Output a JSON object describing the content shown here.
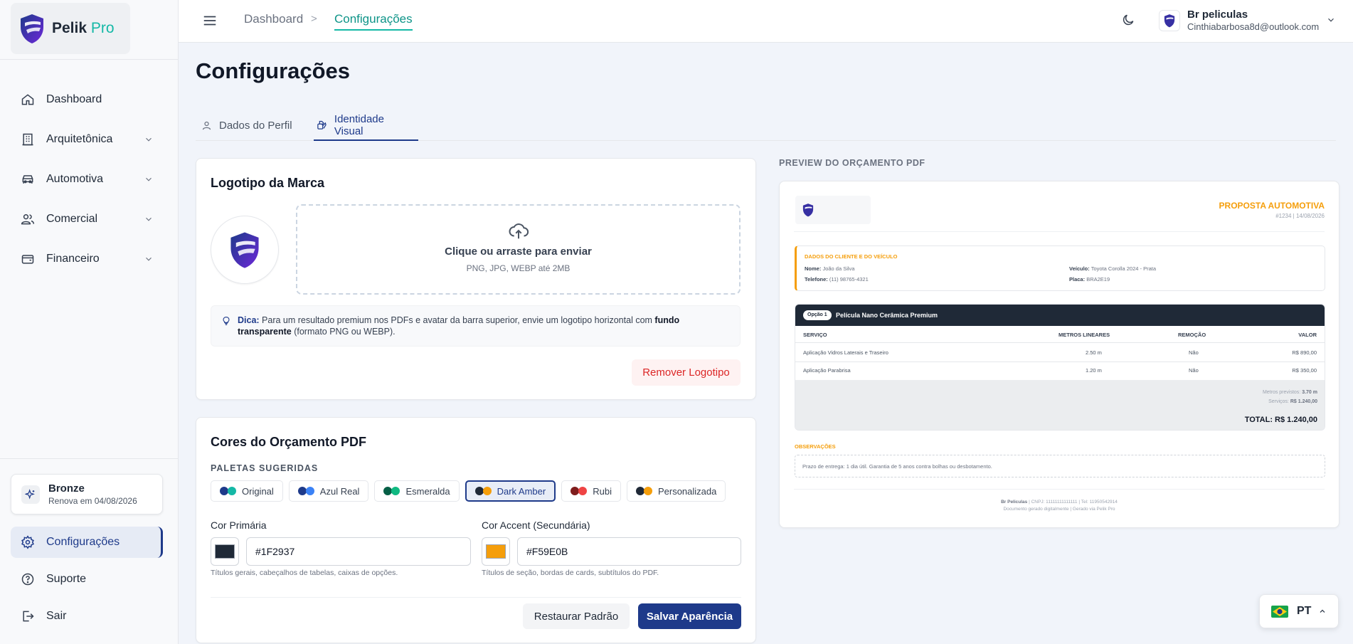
{
  "brand": {
    "name": "Pelik",
    "suffix": "Pro"
  },
  "sidebar": {
    "items": [
      {
        "label": "Dashboard",
        "icon": "home-icon"
      },
      {
        "label": "Arquitetônica",
        "icon": "building-icon"
      },
      {
        "label": "Automotiva",
        "icon": "car-icon"
      },
      {
        "label": "Comercial",
        "icon": "users-icon"
      },
      {
        "label": "Financeiro",
        "icon": "wallet-icon"
      }
    ],
    "plan": {
      "title": "Bronze",
      "renew": "Renova em 04/08/2026"
    },
    "bottom": [
      {
        "label": "Configurações",
        "icon": "gear-icon"
      },
      {
        "label": "Suporte",
        "icon": "help-circle-icon"
      },
      {
        "label": "Sair",
        "icon": "logout-icon"
      }
    ]
  },
  "topbar": {
    "breadcrumb": [
      "Dashboard",
      "Configurações"
    ],
    "separator": ">",
    "user": {
      "name": "Br peliculas",
      "email": "Cinthiabarbosa8d@outlook.com"
    }
  },
  "page": {
    "title": "Configurações",
    "tabs": [
      {
        "label": "Dados do Perfil",
        "icon": "user-icon"
      },
      {
        "label": "Identidade Visual",
        "icon": "palette-icon"
      }
    ]
  },
  "logo_card": {
    "title": "Logotipo da Marca",
    "upload_main": "Clique ou arraste para enviar",
    "upload_sub": "PNG, JPG, WEBP até 2MB",
    "tip_label": "Dica:",
    "tip_text1": " Para um resultado premium nos PDFs e avatar da barra superior, envie um logotipo horizontal com ",
    "tip_bold": "fundo transparente",
    "tip_text2": " (formato PNG ou WEBP).",
    "remove_label": "Remover Logotipo"
  },
  "colors_card": {
    "title": "Cores do Orçamento PDF",
    "palettes_label": "PALETAS SUGERIDAS",
    "palettes": [
      {
        "label": "Original",
        "c1": "#1e3a8a",
        "c2": "#14b8a6"
      },
      {
        "label": "Azul Real",
        "c1": "#1e3a8a",
        "c2": "#3b82f6"
      },
      {
        "label": "Esmeralda",
        "c1": "#065f46",
        "c2": "#10b981"
      },
      {
        "label": "Dark Amber",
        "c1": "#1f2937",
        "c2": "#f59e0b"
      },
      {
        "label": "Rubi",
        "c1": "#7f1d1d",
        "c2": "#ef4444"
      },
      {
        "label": "Personalizada",
        "c1": "#1f2937",
        "c2": "#f59e0b"
      }
    ],
    "selected_palette": "Dark Amber",
    "primary_label": "Cor Primária",
    "primary_value": "#1F2937",
    "primary_hint": "Títulos gerais, cabeçalhos de tabelas, caixas de opções.",
    "accent_label": "Cor Accent (Secundária)",
    "accent_value": "#F59E0B",
    "accent_hint": "Títulos de seção, bordas de cards, subtítulos do PDF.",
    "restore_label": "Restaurar Padrão",
    "save_label": "Salvar Aparência"
  },
  "preview": {
    "label": "PREVIEW DO ORÇAMENTO PDF",
    "title": "PROPOSTA AUTOMOTIVA",
    "subtitle": "#1234 | 14/08/2026",
    "client_title": "DADOS DO CLIENTE E DO VEÍCULO",
    "nome_label": "Nome:",
    "nome_value": "João da Silva",
    "telefone_label": "Telefone:",
    "telefone_value": "(11) 98765-4321",
    "veiculo_label": "Veículo:",
    "veiculo_value": "Toyota Corolla 2024 - Prata",
    "placa_label": "Placa:",
    "placa_value": "BRA2E19",
    "option_pill": "Opção 1",
    "option_name": "Película Nano Cerâmica Premium",
    "headers": [
      "SERVIÇO",
      "METROS LINEARES",
      "REMOÇÃO",
      "VALOR"
    ],
    "rows": [
      [
        "Aplicação Vidros Laterais e Traseiro",
        "2.50 m",
        "Não",
        "R$ 890,00"
      ],
      [
        "Aplicação Parabrisa",
        "1.20 m",
        "Não",
        "R$ 350,00"
      ]
    ],
    "metros_label": "Metros previstos:",
    "metros_value": "3.70 m",
    "servicos_label": "Serviços:",
    "servicos_value": "R$ 1.240,00",
    "total": "TOTAL: R$ 1.240,00",
    "obs_title": "OBSERVAÇÕES",
    "obs_text": "Prazo de entrega: 1 dia útil. Garantia de 5 anos contra bolhas ou desbotamento.",
    "footer_company": "Br Peliculas",
    "footer_details": " | CNPJ: 11111111111111 | Tel: 11950542914",
    "footer_line2": "Documento gerado digitalmente | Gerado via Pelik Pro"
  },
  "lang": {
    "code": "PT"
  },
  "colors": {
    "primary": "#1e3a8a",
    "accent": "#14b8a6",
    "amber": "#f59e0b"
  }
}
